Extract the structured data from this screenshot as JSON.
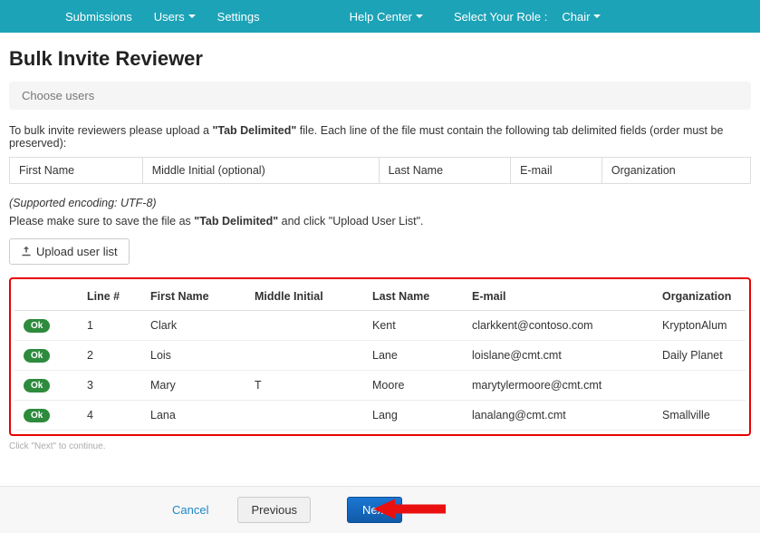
{
  "nav": {
    "submissions": "Submissions",
    "users": "Users",
    "settings": "Settings",
    "help": "Help Center",
    "roleLabel": "Select Your Role :",
    "roleValue": "Chair"
  },
  "page": {
    "title": "Bulk Invite Reviewer",
    "breadcrumb": "Choose users",
    "instruction_pre": "To bulk invite reviewers please upload a ",
    "instruction_bold": "\"Tab Delimited\"",
    "instruction_post": " file. Each line of the file must contain the following tab delimited fields (order must be preserved):",
    "fields": [
      "First Name",
      "Middle Initial (optional)",
      "Last Name",
      "E-mail",
      "Organization"
    ],
    "supported": "(Supported encoding: UTF-8)",
    "save_pre": "Please make sure to save the file as ",
    "save_bold": "\"Tab Delimited\"",
    "save_mid": " and click ",
    "save_q": "\"Upload User List\".",
    "uploadBtn": "Upload user list",
    "continueNote": "Click \"Next\" to continue."
  },
  "results": {
    "headers": {
      "status": "",
      "line": "Line #",
      "first": "First Name",
      "middle": "Middle Initial",
      "last": "Last Name",
      "email": "E-mail",
      "org": "Organization"
    },
    "ok": "Ok",
    "rows": [
      {
        "line": "1",
        "first": "Clark",
        "middle": "",
        "last": "Kent",
        "email": "clarkkent@contoso.com",
        "org": "KryptonAlum"
      },
      {
        "line": "2",
        "first": "Lois",
        "middle": "",
        "last": "Lane",
        "email": "loislane@cmt.cmt",
        "org": "Daily Planet"
      },
      {
        "line": "3",
        "first": "Mary",
        "middle": "T",
        "last": "Moore",
        "email": "marytylermoore@cmt.cmt",
        "org": ""
      },
      {
        "line": "4",
        "first": "Lana",
        "middle": "",
        "last": "Lang",
        "email": "lanalang@cmt.cmt",
        "org": "Smallville"
      }
    ]
  },
  "footer": {
    "cancel": "Cancel",
    "previous": "Previous",
    "next": "Next"
  }
}
